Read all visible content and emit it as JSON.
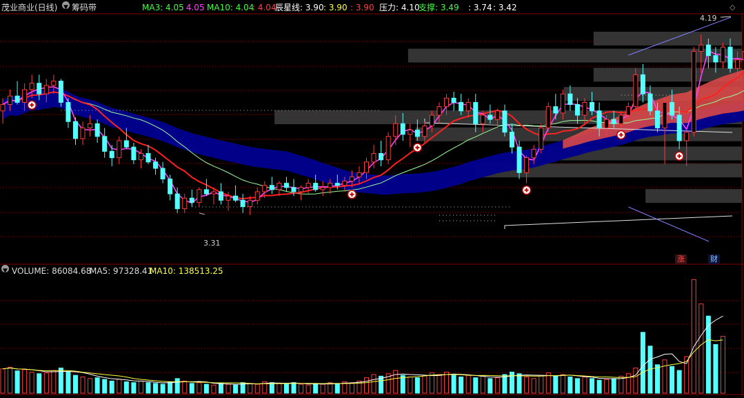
{
  "header": {
    "stock_name": "茂业商业(日线)",
    "indicator_name": "筹码带",
    "ma3_label": "MA3: 4.05",
    "ma3_value": ": 4.05",
    "ma10_label": "MA10: 4.04",
    "ma10_value": ": 4.04",
    "chenxing_label": "辰星线: 3.90",
    "chenxing_v2": ": 3.90",
    "chenxing_v3": ": 3.90",
    "pressure_label": "压力: 4.10",
    "support_label": "支撑: 3.49",
    "extra1": ": 3.74",
    "extra2": ": 3.42"
  },
  "price_panel": {
    "high_label": "4.19",
    "low_label": "3.31",
    "badge_up": "涨",
    "badge_fin": "财"
  },
  "volume_header": {
    "volume_label": "VOLUME: 86084.68",
    "ma5_label": "MA5: 97328.41",
    "ma10_label": "MA10: 138513.25"
  },
  "colors": {
    "up": "#ff3c3c",
    "down": "#54ffff",
    "ma_fast": "#ff40ff",
    "ma_slow": "#ff2020",
    "ma_green": "#9aff9a",
    "band": "#000090",
    "band_red": "#d84848",
    "grid": "#8a0000",
    "profile": "#3a3a3a"
  },
  "chart_data": {
    "type": "candlestick",
    "title": "茂业商业(日线)",
    "price_range": [
      3.18,
      4.25
    ],
    "ohlc": [
      [
        3.8,
        3.86,
        3.74,
        3.83
      ],
      [
        3.83,
        3.9,
        3.8,
        3.87
      ],
      [
        3.87,
        3.94,
        3.83,
        3.84
      ],
      [
        3.84,
        3.93,
        3.8,
        3.9
      ],
      [
        3.9,
        3.97,
        3.86,
        3.93
      ],
      [
        3.93,
        3.97,
        3.85,
        3.88
      ],
      [
        3.88,
        3.95,
        3.84,
        3.92
      ],
      [
        3.92,
        3.97,
        3.88,
        3.94
      ],
      [
        3.94,
        3.95,
        3.82,
        3.84
      ],
      [
        3.84,
        3.86,
        3.72,
        3.75
      ],
      [
        3.75,
        3.77,
        3.64,
        3.67
      ],
      [
        3.67,
        3.75,
        3.64,
        3.72
      ],
      [
        3.72,
        3.78,
        3.68,
        3.74
      ],
      [
        3.74,
        3.76,
        3.65,
        3.68
      ],
      [
        3.68,
        3.72,
        3.58,
        3.61
      ],
      [
        3.61,
        3.64,
        3.54,
        3.58
      ],
      [
        3.58,
        3.68,
        3.55,
        3.66
      ],
      [
        3.66,
        3.72,
        3.62,
        3.63
      ],
      [
        3.63,
        3.65,
        3.55,
        3.57
      ],
      [
        3.57,
        3.62,
        3.53,
        3.6
      ],
      [
        3.6,
        3.64,
        3.55,
        3.56
      ],
      [
        3.56,
        3.58,
        3.5,
        3.53
      ],
      [
        3.53,
        3.56,
        3.46,
        3.48
      ],
      [
        3.48,
        3.5,
        3.38,
        3.41
      ],
      [
        3.41,
        3.44,
        3.32,
        3.34
      ],
      [
        3.34,
        3.41,
        3.32,
        3.39
      ],
      [
        3.39,
        3.43,
        3.35,
        3.37
      ],
      [
        3.37,
        3.44,
        3.35,
        3.43
      ],
      [
        3.43,
        3.48,
        3.4,
        3.41
      ],
      [
        3.41,
        3.44,
        3.36,
        3.42
      ],
      [
        3.42,
        3.46,
        3.36,
        3.38
      ],
      [
        3.38,
        3.42,
        3.33,
        3.4
      ],
      [
        3.4,
        3.45,
        3.37,
        3.38
      ],
      [
        3.38,
        3.41,
        3.32,
        3.35
      ],
      [
        3.35,
        3.4,
        3.31,
        3.38
      ],
      [
        3.38,
        3.44,
        3.36,
        3.42
      ],
      [
        3.42,
        3.47,
        3.39,
        3.45
      ],
      [
        3.45,
        3.49,
        3.41,
        3.43
      ],
      [
        3.43,
        3.47,
        3.4,
        3.46
      ],
      [
        3.46,
        3.49,
        3.42,
        3.44
      ],
      [
        3.44,
        3.48,
        3.4,
        3.42
      ],
      [
        3.42,
        3.45,
        3.38,
        3.44
      ],
      [
        3.44,
        3.48,
        3.41,
        3.46
      ],
      [
        3.46,
        3.5,
        3.42,
        3.43
      ],
      [
        3.43,
        3.47,
        3.4,
        3.44
      ],
      [
        3.44,
        3.48,
        3.41,
        3.46
      ],
      [
        3.46,
        3.5,
        3.43,
        3.45
      ],
      [
        3.45,
        3.49,
        3.42,
        3.47
      ],
      [
        3.47,
        3.52,
        3.44,
        3.49
      ],
      [
        3.49,
        3.54,
        3.46,
        3.51
      ],
      [
        3.51,
        3.58,
        3.48,
        3.56
      ],
      [
        3.56,
        3.64,
        3.53,
        3.6
      ],
      [
        3.6,
        3.66,
        3.54,
        3.57
      ],
      [
        3.57,
        3.7,
        3.55,
        3.68
      ],
      [
        3.68,
        3.78,
        3.64,
        3.74
      ],
      [
        3.74,
        3.79,
        3.66,
        3.69
      ],
      [
        3.69,
        3.74,
        3.63,
        3.71
      ],
      [
        3.71,
        3.76,
        3.66,
        3.68
      ],
      [
        3.68,
        3.75,
        3.65,
        3.73
      ],
      [
        3.73,
        3.8,
        3.7,
        3.78
      ],
      [
        3.78,
        3.84,
        3.74,
        3.82
      ],
      [
        3.82,
        3.88,
        3.78,
        3.86
      ],
      [
        3.86,
        3.89,
        3.8,
        3.84
      ],
      [
        3.84,
        3.88,
        3.78,
        3.8
      ],
      [
        3.8,
        3.86,
        3.77,
        3.84
      ],
      [
        3.84,
        3.88,
        3.7,
        3.74
      ],
      [
        3.74,
        3.8,
        3.7,
        3.78
      ],
      [
        3.78,
        3.83,
        3.74,
        3.76
      ],
      [
        3.76,
        3.81,
        3.72,
        3.8
      ],
      [
        3.8,
        3.83,
        3.68,
        3.7
      ],
      [
        3.7,
        3.74,
        3.6,
        3.63
      ],
      [
        3.63,
        3.66,
        3.48,
        3.51
      ],
      [
        3.51,
        3.59,
        3.46,
        3.58
      ],
      [
        3.58,
        3.64,
        3.55,
        3.62
      ],
      [
        3.62,
        3.74,
        3.6,
        3.72
      ],
      [
        3.72,
        3.84,
        3.7,
        3.82
      ],
      [
        3.82,
        3.88,
        3.76,
        3.79
      ],
      [
        3.79,
        3.9,
        3.76,
        3.88
      ],
      [
        3.88,
        3.92,
        3.8,
        3.83
      ],
      [
        3.83,
        3.86,
        3.74,
        3.78
      ],
      [
        3.78,
        3.86,
        3.74,
        3.84
      ],
      [
        3.84,
        3.89,
        3.78,
        3.8
      ],
      [
        3.8,
        3.84,
        3.68,
        3.72
      ],
      [
        3.72,
        3.78,
        3.68,
        3.76
      ],
      [
        3.76,
        3.8,
        3.72,
        3.74
      ],
      [
        3.74,
        3.8,
        3.72,
        3.78
      ],
      [
        3.78,
        3.84,
        3.76,
        3.82
      ],
      [
        3.82,
        4.0,
        3.8,
        3.97
      ],
      [
        3.97,
        4.02,
        3.84,
        3.88
      ],
      [
        3.88,
        3.92,
        3.78,
        3.8
      ],
      [
        3.8,
        3.84,
        3.7,
        3.72
      ],
      [
        3.72,
        3.86,
        3.55,
        3.84
      ],
      [
        3.84,
        3.9,
        3.76,
        3.78
      ],
      [
        3.78,
        3.82,
        3.62,
        3.66
      ],
      [
        3.66,
        3.72,
        3.54,
        3.7
      ],
      [
        3.7,
        4.1,
        3.68,
        4.08
      ],
      [
        4.08,
        4.16,
        3.98,
        4.11
      ],
      [
        4.11,
        4.14,
        4.0,
        4.06
      ],
      [
        4.06,
        4.1,
        3.98,
        4.03
      ],
      [
        4.03,
        4.12,
        4.0,
        4.1
      ],
      [
        4.1,
        4.14,
        3.98,
        4.0
      ],
      [
        4.0,
        4.08,
        3.96,
        4.04
      ],
      [
        4.04,
        4.1,
        4.02,
        4.08
      ],
      [
        4.08,
        4.19,
        4.04,
        4.17
      ]
    ],
    "volume": [
      60,
      64,
      55,
      58,
      52,
      48,
      50,
      56,
      62,
      52,
      44,
      40,
      36,
      38,
      34,
      30,
      34,
      28,
      26,
      30,
      26,
      24,
      22,
      28,
      36,
      30,
      24,
      26,
      22,
      20,
      24,
      22,
      20,
      26,
      24,
      22,
      28,
      26,
      24,
      22,
      26,
      22,
      20,
      24,
      22,
      26,
      24,
      28,
      26,
      30,
      38,
      46,
      42,
      48,
      56,
      44,
      40,
      38,
      44,
      50,
      46,
      52,
      44,
      40,
      44,
      38,
      42,
      36,
      38,
      46,
      52,
      48,
      40,
      36,
      44,
      50,
      42,
      46,
      40,
      36,
      40,
      36,
      32,
      34,
      36,
      42,
      48,
      62,
      150,
      116,
      70,
      82,
      66,
      56,
      90,
      280,
      220,
      190,
      120,
      140
    ],
    "ma3": [],
    "ma10": [],
    "volume_ma5": [],
    "volume_ma10": []
  }
}
